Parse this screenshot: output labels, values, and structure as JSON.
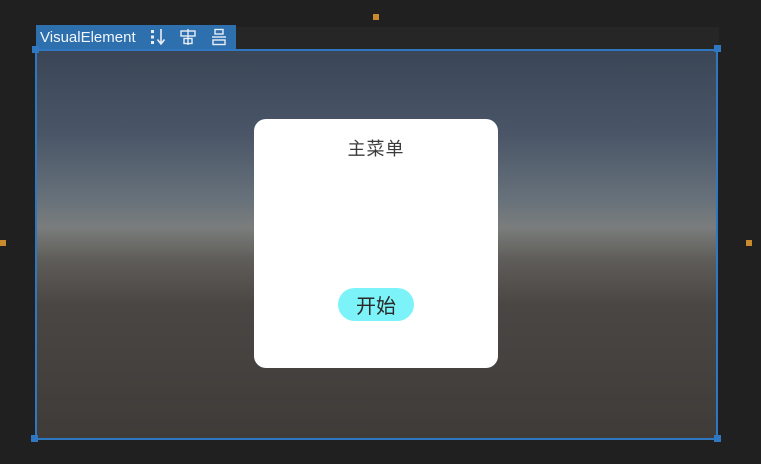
{
  "toolbar": {
    "element_label": "VisualElement",
    "icons": [
      "sort-down-icon",
      "align-center-icon",
      "distribute-vertical-icon"
    ]
  },
  "panel": {
    "title": "主菜单",
    "start_button_label": "开始"
  },
  "colors": {
    "selection": "#2f77c0",
    "handle_orange": "#c88a2c",
    "start_button_bg": "#7cf3f8",
    "panel_bg": "#ffffff",
    "editor_bg": "#202020"
  }
}
